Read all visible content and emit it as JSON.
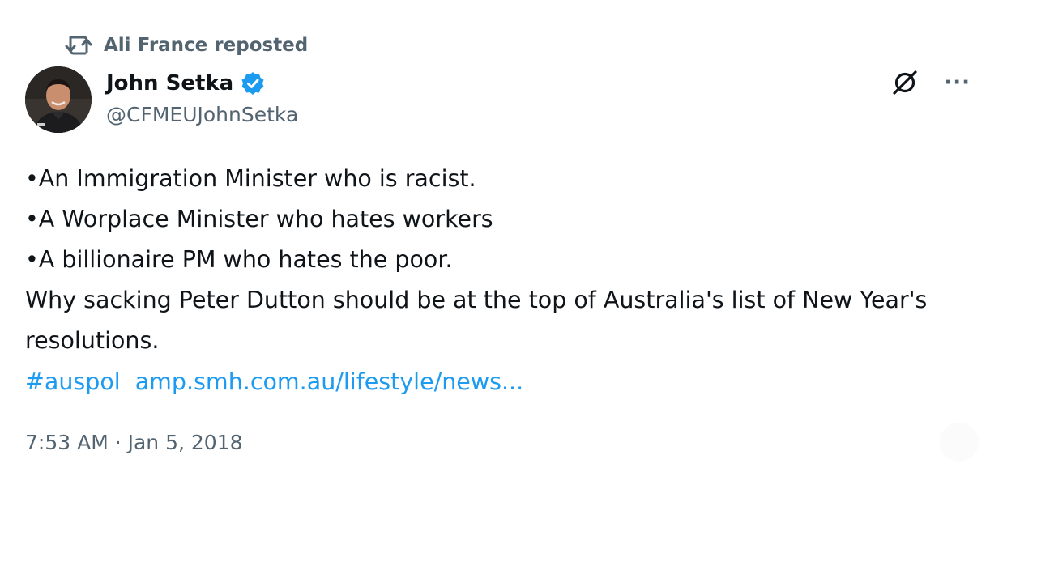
{
  "repost": {
    "icon": "repost-icon",
    "text": "Ali France reposted"
  },
  "author": {
    "avatar_icon": "user-avatar",
    "display_name": "John Setka",
    "verified_icon": "verified-badge-icon",
    "handle": "@CFMEUJohnSetka"
  },
  "actions": {
    "grok_icon": "grok-icon",
    "more_icon": "more-options-icon",
    "more_label": "···"
  },
  "tweet": {
    "lines": [
      "•An Immigration Minister who is racist.",
      "•A Worplace Minister who hates workers",
      "•A billionaire PM who hates the poor.",
      "Why sacking Peter Dutton should be at the top of Australia's list of New Year's resolutions."
    ],
    "hashtag": "#auspol",
    "link": "amp.smh.com.au/lifestyle/news..."
  },
  "timestamp": "7:53 AM · Jan 5, 2018",
  "colors": {
    "accent": "#1d9bf0",
    "secondary_text": "#536471",
    "primary_text": "#0f1419"
  }
}
